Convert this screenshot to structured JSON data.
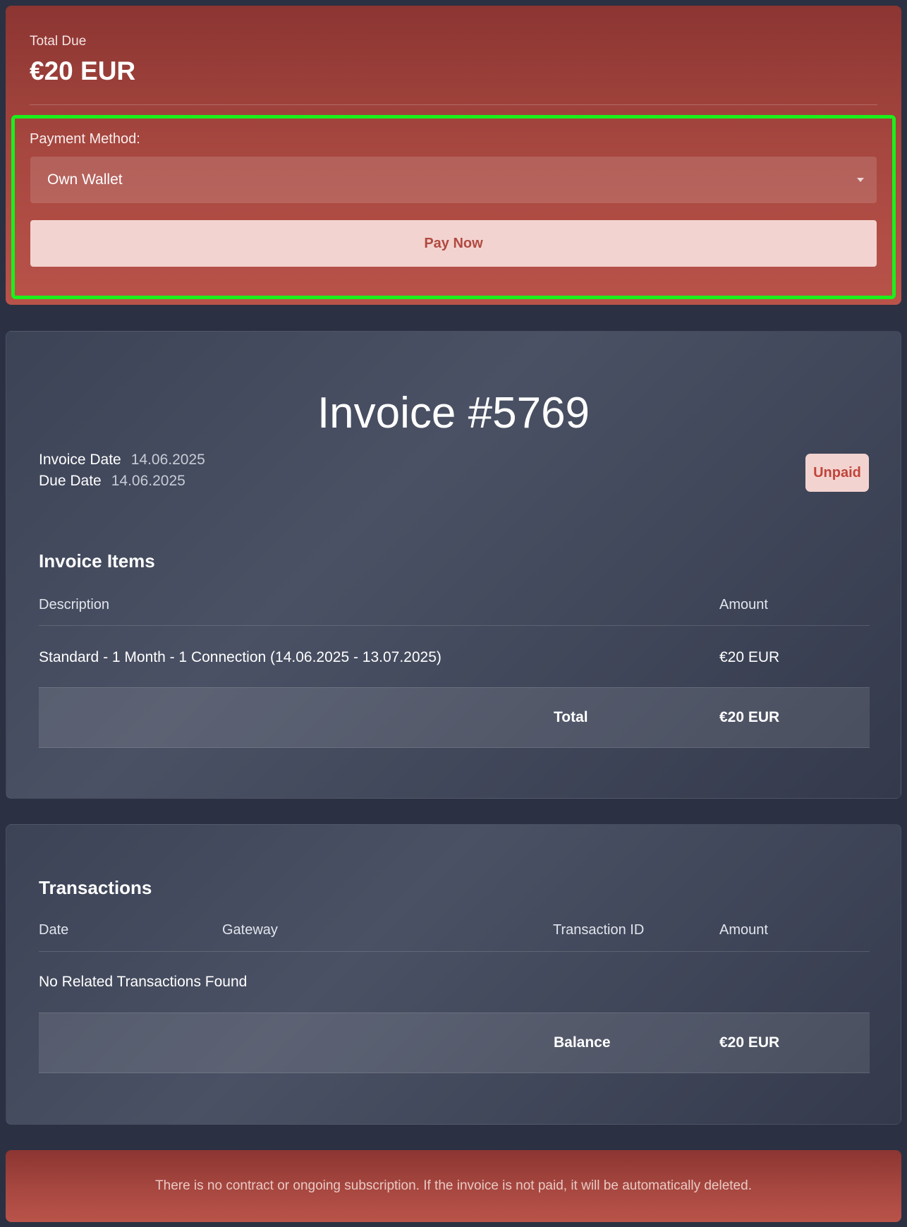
{
  "pay": {
    "total_label": "Total Due",
    "total_value": "€20 EUR",
    "payment_method_label": "Payment Method:",
    "payment_method_selected": "Own Wallet",
    "pay_button": "Pay Now"
  },
  "invoice": {
    "title": "Invoice #5769",
    "invoice_date_label": "Invoice Date",
    "invoice_date": "14.06.2025",
    "due_date_label": "Due Date",
    "due_date": "14.06.2025",
    "status": "Unpaid",
    "items_title": "Invoice Items",
    "headers": {
      "description": "Description",
      "amount": "Amount"
    },
    "items": [
      {
        "description": "Standard - 1 Month - 1 Connection (14.06.2025 - 13.07.2025)",
        "amount": "€20 EUR"
      }
    ],
    "total_label": "Total",
    "total_value": "€20 EUR"
  },
  "transactions": {
    "title": "Transactions",
    "headers": {
      "date": "Date",
      "gateway": "Gateway",
      "transaction_id": "Transaction ID",
      "amount": "Amount"
    },
    "empty_message": "No Related Transactions Found",
    "balance_label": "Balance",
    "balance_value": "€20 EUR"
  },
  "notice": "There is no contract or ongoing subscription. If the invoice is not paid, it will be automatically deleted.",
  "colors": {
    "accent_red": "#a5463f",
    "focus_outline": "#1bf01b",
    "badge_bg": "#f3d3d0",
    "badge_text": "#c0443a"
  }
}
